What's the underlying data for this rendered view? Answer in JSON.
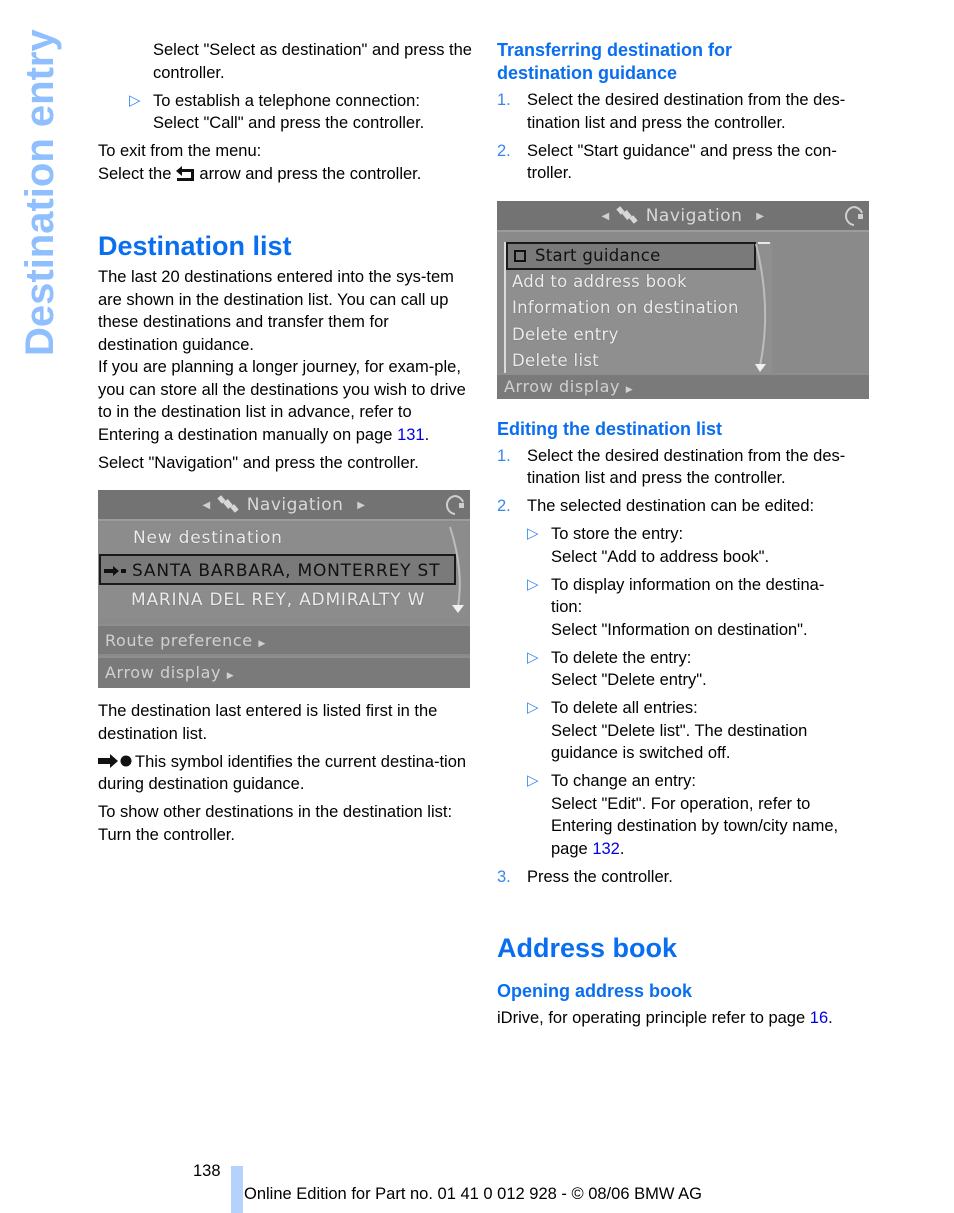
{
  "side_tab": {
    "title": "Destination entry",
    "color": "#8fbfff"
  },
  "left": {
    "intro_continuation": "Select \"Select as destination\" and press the controller.",
    "bullet_call": {
      "lead": "To establish a telephone connection:",
      "text": "Select \"Call\" and press the controller."
    },
    "exit_menu_line1": "To exit from the menu:",
    "exit_menu_line2_before": "Select the",
    "exit_menu_icon": "back-arrow-icon",
    "exit_menu_line2_after": "arrow and press the controller.",
    "section_heading": "Destination list",
    "para1": "The last 20 destinations entered into the sys-tem are shown in the destination list. You can call up these destinations and transfer them for destination guidance.",
    "para2_before_link": "If you are planning a longer journey, for exam-ple, you can store all the destinations you wish to drive to in the destination list in advance, refer to Entering a destination manually on page",
    "para2_link": "131",
    "para2_after": ".",
    "select_nav": "Select \"Navigation\" and press the controller.",
    "screen1": {
      "header": "Navigation",
      "items": [
        {
          "label": "New destination",
          "selected": false
        },
        {
          "label": "SANTA BARBARA, MONTERREY ST",
          "selected": true,
          "icon": "current-destination-icon"
        },
        {
          "label": "MARINA DEL REY, ADMIRALTY W",
          "selected": false
        }
      ],
      "bars": [
        "Route preference",
        "Arrow display"
      ]
    },
    "para_last_entered": "The destination last entered is listed first in the destination list.",
    "symbol_icon": "current-destination-icon",
    "symbol_text": "This symbol identifies the current destina-tion during destination guidance.",
    "show_other_line1": "To show other destinations in the destination list:",
    "show_other_line2": "Turn the controller."
  },
  "right": {
    "transfer_heading": "Transferring destination for destination guidance",
    "transfer_steps": [
      {
        "n": "1.",
        "text": "Select the desired destination from the des-tination list and press the controller."
      },
      {
        "n": "2.",
        "text": "Select \"Start guidance\" and press the con-troller."
      }
    ],
    "screen2": {
      "header": "Navigation",
      "items": [
        {
          "label": "Start guidance",
          "selected": true
        },
        {
          "label": "Add to address book",
          "selected": false
        },
        {
          "label": "Information on destination",
          "selected": false
        },
        {
          "label": "Delete entry",
          "selected": false
        },
        {
          "label": "Delete list",
          "selected": false
        }
      ],
      "bars": [
        "Arrow display"
      ]
    },
    "editing_heading": "Editing the destination list",
    "editing_steps": [
      {
        "n": "1.",
        "text": "Select the desired destination from the des-tination list and press the controller."
      },
      {
        "n": "2.",
        "text": "The selected destination can be edited:"
      }
    ],
    "editing_bullets": [
      {
        "lead": "To store the entry:",
        "text": "Select \"Add to address book\"."
      },
      {
        "lead": "To display information on the destina-tion:",
        "text": "Select \"Information on destination\"."
      },
      {
        "lead": "To delete the entry:",
        "text": "Select \"Delete entry\"."
      },
      {
        "lead": "To delete all entries:",
        "text": "Select \"Delete list\". The destination guidance is switched off."
      },
      {
        "lead": "To change an entry:",
        "text": "Select \"Edit\". For operation, refer to Entering destination by town/city name, page",
        "link": "132",
        "after": "."
      }
    ],
    "editing_step3": {
      "n": "3.",
      "text": "Press the controller."
    },
    "address_heading": "Address book",
    "opening_heading": "Opening address book",
    "opening_text_before": "iDrive, for operating principle refer to page",
    "opening_link": "16",
    "opening_after": "."
  },
  "footer": {
    "page_number": "138",
    "edition": "Online Edition for Part no. 01 41 0 012 928 - © 08/06 BMW AG"
  },
  "colors": {
    "heading": "#0a6ef0",
    "link": "#0000e6",
    "bullet": "#3a86f0",
    "footer_bar": "#b4d2fb"
  }
}
